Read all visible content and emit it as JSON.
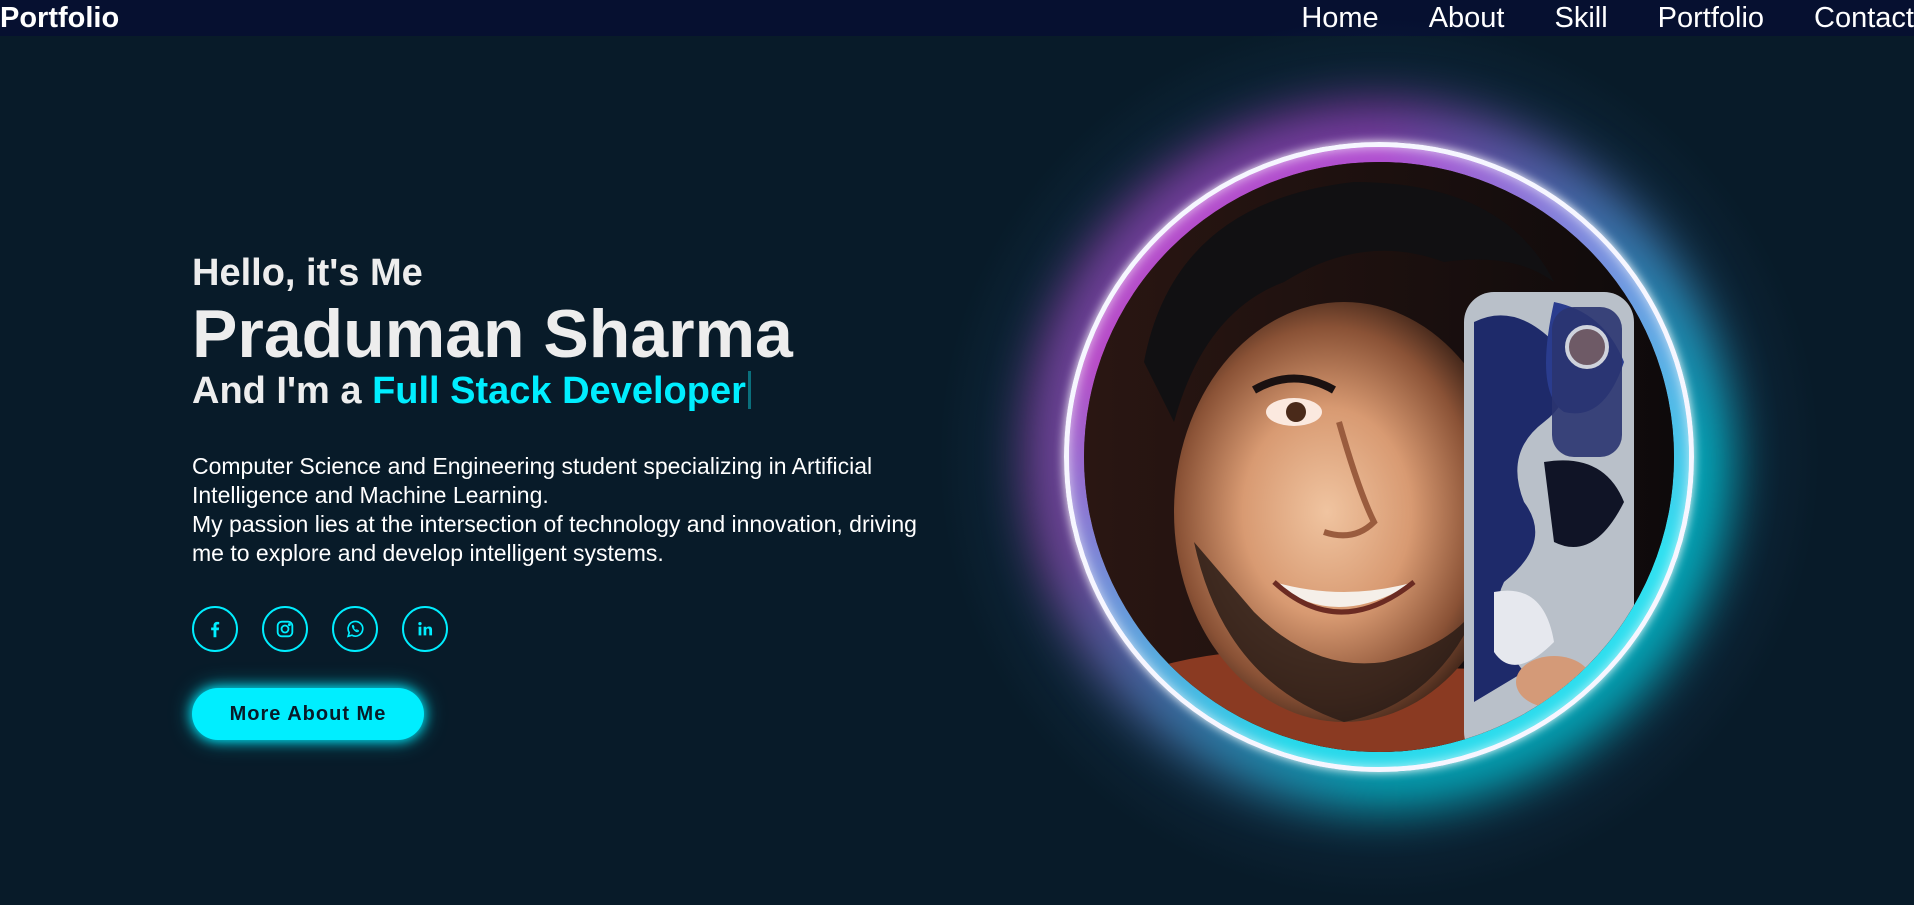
{
  "navbar": {
    "logo": "Portfolio",
    "links": [
      "Home",
      "About",
      "Skill",
      "Portfolio",
      "Contact"
    ]
  },
  "home": {
    "greeting": "Hello, it's Me",
    "name": "Praduman Sharma",
    "role_prefix": "And I'm a",
    "role_highlight": "Full Stack Developer",
    "description_line1": "Computer Science and Engineering student specializing in Artificial Intelligence and Machine Learning.",
    "description_line2": "My passion lies at the intersection of technology and innovation, driving me to explore and develop intelligent systems.",
    "socials": [
      {
        "icon": "facebook-icon"
      },
      {
        "icon": "instagram-icon"
      },
      {
        "icon": "whatsapp-icon"
      },
      {
        "icon": "linkedin-icon"
      }
    ],
    "button_label": "More About Me"
  },
  "colors": {
    "background": "#081b29",
    "navbar": "#061030",
    "accent": "#00eeff",
    "text": "#ededed"
  }
}
